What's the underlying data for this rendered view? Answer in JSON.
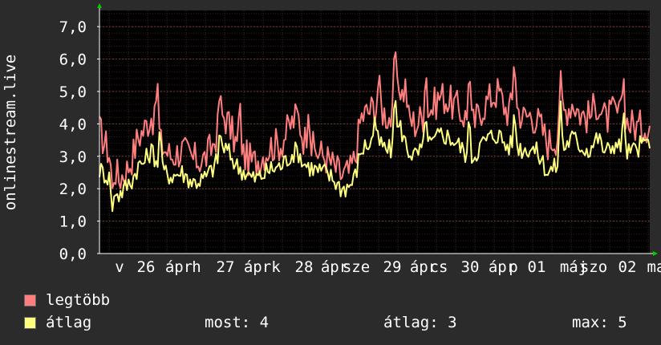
{
  "chart_data": {
    "type": "line",
    "ylabel": "onlinestream.live",
    "ylim": [
      0,
      7.5
    ],
    "y_ticks": [
      "0,0",
      "1,0",
      "2,0",
      "3,0",
      "4,0",
      "5,0",
      "6,0",
      "7,0"
    ],
    "x_tick_labels": [
      "v",
      "26",
      "ápr",
      "h",
      "27",
      "ápr",
      "k",
      "28",
      "ápr",
      "sze",
      "29",
      "ápr",
      "cs",
      "30",
      "ápr",
      "p",
      "01",
      "máj",
      "szo",
      "02",
      "ma"
    ],
    "grid": true,
    "series": [
      {
        "name": "legtöbb",
        "color": "#ff7f7f",
        "anchors": [
          [
            0,
            3.8
          ],
          [
            0.02,
            3.0
          ],
          [
            0.035,
            2.3
          ],
          [
            0.05,
            2.6
          ],
          [
            0.06,
            3.0
          ],
          [
            0.07,
            3.6
          ],
          [
            0.08,
            3.8
          ],
          [
            0.095,
            4.3
          ],
          [
            0.11,
            3.4
          ],
          [
            0.13,
            3.0
          ],
          [
            0.15,
            3.2
          ],
          [
            0.17,
            2.9
          ],
          [
            0.19,
            2.9
          ],
          [
            0.205,
            3.3
          ],
          [
            0.215,
            3.8
          ],
          [
            0.225,
            4.3
          ],
          [
            0.235,
            4.0
          ],
          [
            0.25,
            3.3
          ],
          [
            0.265,
            3.0
          ],
          [
            0.28,
            2.8
          ],
          [
            0.295,
            3.0
          ],
          [
            0.31,
            3.3
          ],
          [
            0.33,
            3.4
          ],
          [
            0.345,
            3.9
          ],
          [
            0.36,
            4.3
          ],
          [
            0.37,
            3.6
          ],
          [
            0.39,
            3.2
          ],
          [
            0.41,
            3.0
          ],
          [
            0.425,
            2.7
          ],
          [
            0.44,
            2.4
          ],
          [
            0.455,
            2.5
          ],
          [
            0.465,
            3.0
          ],
          [
            0.475,
            4.2
          ],
          [
            0.49,
            4.4
          ],
          [
            0.505,
            4.6
          ],
          [
            0.52,
            4.3
          ],
          [
            0.535,
            4.1
          ],
          [
            0.545,
            5.3
          ],
          [
            0.56,
            4.2
          ],
          [
            0.575,
            4.0
          ],
          [
            0.59,
            4.3
          ],
          [
            0.605,
            4.5
          ],
          [
            0.62,
            4.9
          ],
          [
            0.635,
            4.7
          ],
          [
            0.65,
            4.5
          ],
          [
            0.665,
            4.2
          ],
          [
            0.68,
            4.0
          ],
          [
            0.695,
            4.5
          ],
          [
            0.71,
            4.8
          ],
          [
            0.725,
            5.0
          ],
          [
            0.74,
            4.4
          ],
          [
            0.755,
            4.6
          ],
          [
            0.77,
            4.2
          ],
          [
            0.785,
            4.3
          ],
          [
            0.8,
            4.0
          ],
          [
            0.815,
            3.4
          ],
          [
            0.83,
            3.6
          ],
          [
            0.845,
            4.4
          ],
          [
            0.86,
            4.7
          ],
          [
            0.875,
            4.3
          ],
          [
            0.89,
            4.2
          ],
          [
            0.905,
            4.7
          ],
          [
            0.92,
            4.1
          ],
          [
            0.935,
            4.4
          ],
          [
            0.95,
            4.2
          ],
          [
            0.965,
            4.0
          ],
          [
            0.98,
            3.9
          ],
          [
            1,
            4.0
          ]
        ],
        "spikes": [
          [
            0.024,
            1.9
          ],
          [
            0.105,
            5.6
          ],
          [
            0.219,
            5.1
          ],
          [
            0.255,
            4.9
          ],
          [
            0.38,
            4.5
          ],
          [
            0.508,
            5.6
          ],
          [
            0.537,
            6.9
          ],
          [
            0.556,
            5.4
          ],
          [
            0.593,
            5.8
          ],
          [
            0.672,
            5.9
          ],
          [
            0.754,
            6.2
          ],
          [
            0.838,
            5.7
          ],
          [
            0.952,
            5.7
          ]
        ]
      },
      {
        "name": "átlag",
        "color": "#ffff80",
        "anchors": [
          [
            0,
            2.6
          ],
          [
            0.02,
            2.3
          ],
          [
            0.035,
            1.8
          ],
          [
            0.05,
            2.1
          ],
          [
            0.06,
            2.3
          ],
          [
            0.07,
            2.7
          ],
          [
            0.08,
            2.8
          ],
          [
            0.095,
            3.2
          ],
          [
            0.11,
            2.6
          ],
          [
            0.13,
            2.4
          ],
          [
            0.15,
            2.5
          ],
          [
            0.17,
            2.2
          ],
          [
            0.19,
            2.3
          ],
          [
            0.205,
            2.6
          ],
          [
            0.215,
            2.9
          ],
          [
            0.225,
            3.3
          ],
          [
            0.235,
            3.1
          ],
          [
            0.25,
            2.7
          ],
          [
            0.265,
            2.5
          ],
          [
            0.28,
            2.3
          ],
          [
            0.295,
            2.4
          ],
          [
            0.31,
            2.6
          ],
          [
            0.33,
            2.7
          ],
          [
            0.345,
            3.0
          ],
          [
            0.36,
            3.2
          ],
          [
            0.37,
            2.8
          ],
          [
            0.39,
            2.6
          ],
          [
            0.41,
            2.5
          ],
          [
            0.425,
            2.3
          ],
          [
            0.44,
            2.0
          ],
          [
            0.455,
            2.1
          ],
          [
            0.465,
            2.4
          ],
          [
            0.475,
            3.2
          ],
          [
            0.49,
            3.4
          ],
          [
            0.505,
            3.5
          ],
          [
            0.52,
            3.2
          ],
          [
            0.535,
            3.2
          ],
          [
            0.545,
            4.0
          ],
          [
            0.56,
            3.2
          ],
          [
            0.575,
            3.0
          ],
          [
            0.59,
            3.3
          ],
          [
            0.605,
            3.4
          ],
          [
            0.62,
            3.7
          ],
          [
            0.635,
            3.6
          ],
          [
            0.65,
            3.4
          ],
          [
            0.665,
            3.1
          ],
          [
            0.68,
            3.0
          ],
          [
            0.695,
            3.4
          ],
          [
            0.71,
            3.6
          ],
          [
            0.725,
            3.7
          ],
          [
            0.74,
            3.3
          ],
          [
            0.755,
            3.4
          ],
          [
            0.77,
            3.2
          ],
          [
            0.785,
            3.3
          ],
          [
            0.8,
            3.0
          ],
          [
            0.815,
            2.5
          ],
          [
            0.83,
            2.7
          ],
          [
            0.845,
            3.3
          ],
          [
            0.86,
            3.6
          ],
          [
            0.875,
            3.3
          ],
          [
            0.89,
            3.2
          ],
          [
            0.905,
            3.6
          ],
          [
            0.92,
            3.1
          ],
          [
            0.935,
            3.4
          ],
          [
            0.95,
            3.2
          ],
          [
            0.965,
            3.1
          ],
          [
            0.98,
            3.3
          ],
          [
            1,
            3.5
          ]
        ],
        "spikes": [
          [
            0.024,
            1.2
          ],
          [
            0.11,
            4.1
          ],
          [
            0.219,
            3.9
          ],
          [
            0.5,
            4.2
          ],
          [
            0.537,
            5.3
          ],
          [
            0.593,
            4.4
          ],
          [
            0.672,
            4.4
          ],
          [
            0.754,
            4.5
          ],
          [
            0.838,
            4.8
          ],
          [
            0.952,
            4.6
          ]
        ]
      }
    ],
    "legend_position": "bottom-left"
  },
  "stats": {
    "most": "most: 4",
    "atlag": "átlag: 3",
    "max": "max: 5"
  }
}
